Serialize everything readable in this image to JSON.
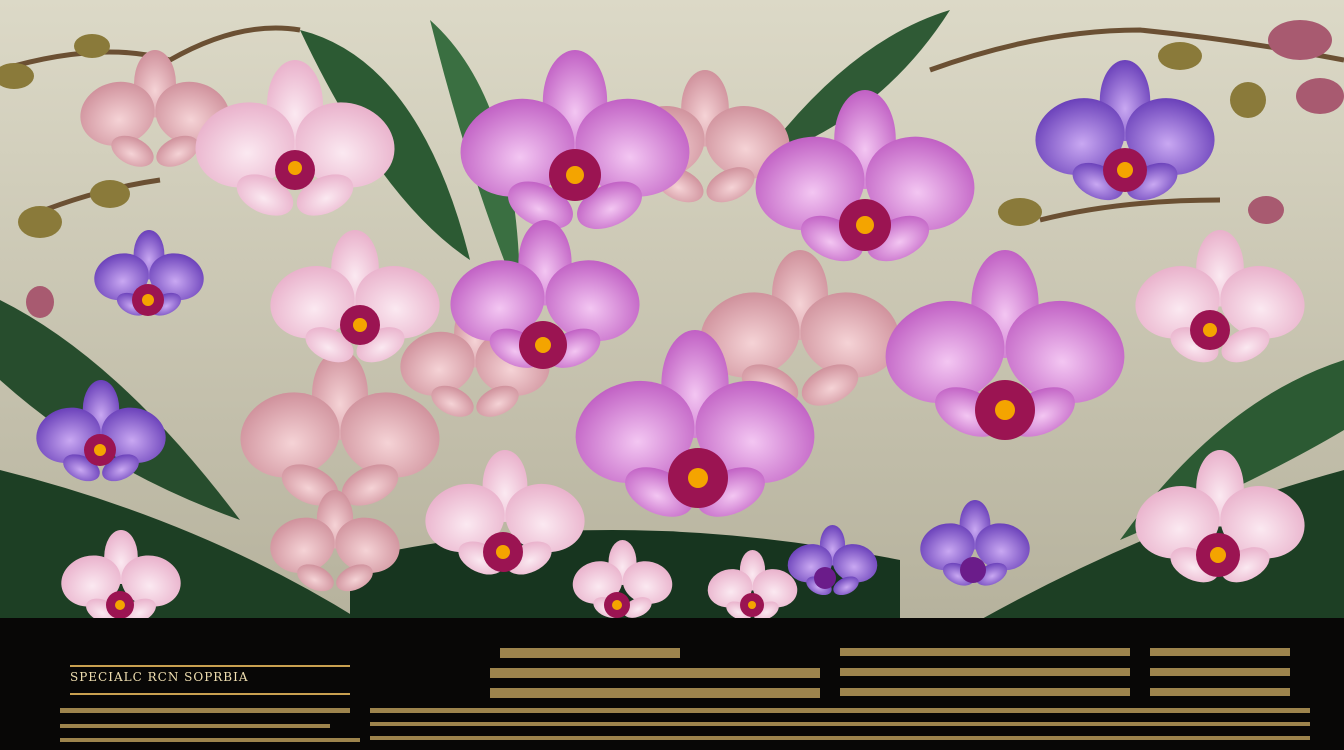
{
  "image": {
    "type": "illustration",
    "colors": {
      "background_top": "#d9d6c3",
      "background_bottom": "#bdb9a4",
      "leaf_dark": "#1f4a2a",
      "leaf_mid": "#2f6a3a",
      "panel": "#080706",
      "gold_text": "#e0b060",
      "pink_petal": "#f3c9dc",
      "magenta_petal": "#d77ad9",
      "purple_petal": "#7a4fcf",
      "lip": "#9b1452",
      "column": "#f4a400"
    },
    "panel_heading": "SPECIALC RCN SOPRBIA"
  }
}
